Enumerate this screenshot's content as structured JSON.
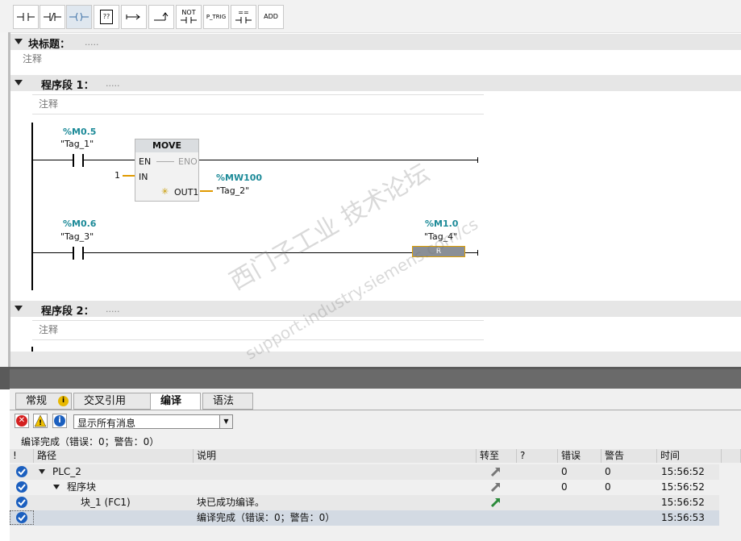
{
  "toolbar": {
    "buttons": [
      {
        "name": "normally-open-contact-icon",
        "label": ""
      },
      {
        "name": "normally-closed-contact-icon",
        "label": ""
      },
      {
        "name": "coil-icon",
        "label": ""
      },
      {
        "name": "empty-box-icon",
        "label": "??"
      },
      {
        "name": "open-branch-icon",
        "label": ""
      },
      {
        "name": "close-branch-icon",
        "label": ""
      },
      {
        "name": "not-contact-icon",
        "label": "NOT"
      },
      {
        "name": "p-trig-icon",
        "label": "P_TRIG"
      },
      {
        "name": "compare-icon",
        "label": "=="
      },
      {
        "name": "add-icon",
        "label": "ADD"
      }
    ]
  },
  "block": {
    "title_label": "块标题：",
    "title_value": ".....",
    "comment": "注释"
  },
  "network1": {
    "label": "程序段 1：",
    "dots": ".....",
    "comment": "注释",
    "contact1": {
      "address": "%M0.5",
      "tag": "\"Tag_1\""
    },
    "move": {
      "title": "MOVE",
      "en": "EN",
      "eno": "ENO",
      "in": "IN",
      "out": "OUT1",
      "in_value": "1",
      "out_address": "%MW100",
      "out_tag": "\"Tag_2\""
    },
    "contact2": {
      "address": "%M0.6",
      "tag": "\"Tag_3\""
    },
    "coil": {
      "address": "%M1.0",
      "tag": "\"Tag_4\"",
      "type": "R"
    }
  },
  "network2": {
    "label": "程序段 2：",
    "dots": ".....",
    "comment": "注释"
  },
  "watermark": {
    "line1": "西门子工业 技术论坛",
    "line2": "support.industry.siemens.com/cs"
  },
  "inspector": {
    "tabs": [
      "常规",
      "交叉引用",
      "编译",
      "语法"
    ],
    "active_tab": "编译",
    "filter": "显示所有消息",
    "summary": "编译完成（错误：0；警告：0）",
    "columns": [
      "!",
      "路径",
      "说明",
      "转至",
      "?",
      "错误",
      "警告",
      "时间"
    ],
    "rows": [
      {
        "path": "PLC_2",
        "desc": "",
        "errors": "0",
        "warnings": "0",
        "time": "15:56:52",
        "goto": true
      },
      {
        "path": "程序块",
        "desc": "",
        "errors": "0",
        "warnings": "0",
        "time": "15:56:52",
        "goto": true
      },
      {
        "path": "块_1 (FC1)",
        "desc": "块已成功编译。",
        "errors": "",
        "warnings": "",
        "time": "15:56:52",
        "goto": true
      },
      {
        "path": "",
        "desc": "编译完成（错误：0；警告：0）",
        "errors": "",
        "warnings": "",
        "time": "15:56:53",
        "goto": false
      }
    ]
  },
  "colors": {
    "tag_address": "#1c8a98",
    "check": "#1b5fbf",
    "goto_green": "#2a8a3a"
  }
}
